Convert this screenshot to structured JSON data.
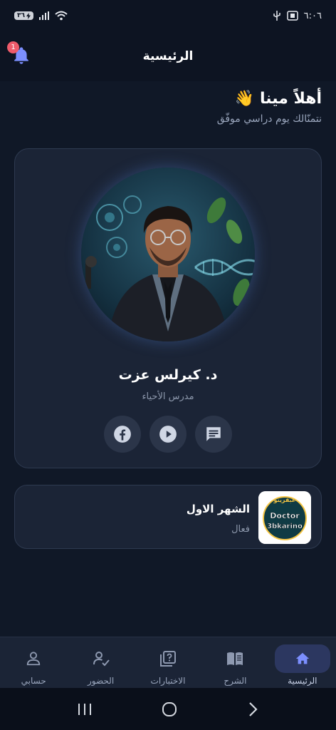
{
  "status_bar": {
    "time": "٦:٠٦",
    "battery": "٣٦"
  },
  "header": {
    "title": "الرئيسية",
    "notification_count": "1"
  },
  "greeting": {
    "title": "أهلاً مينا",
    "wave_emoji": "👋",
    "subtitle": "نتمنّالك يوم دراسي موفّق"
  },
  "teacher": {
    "name": "د. كيرلس عزت",
    "role": "مدرس الأحياء",
    "social": [
      {
        "icon": "facebook-icon"
      },
      {
        "icon": "youtube-play-icon"
      },
      {
        "icon": "chat-icon"
      }
    ]
  },
  "course": {
    "title": "الشهر الاول",
    "status": "فعال",
    "logo": {
      "top_text": "عبقرينو",
      "line1": "Doctor",
      "line2": "3bkarino"
    }
  },
  "bottom_nav": {
    "items": [
      {
        "label": "الرئيسية",
        "icon": "home-icon",
        "active": true
      },
      {
        "label": "الشرح",
        "icon": "book-icon",
        "active": false
      },
      {
        "label": "الاختبارات",
        "icon": "quiz-icon",
        "active": false
      },
      {
        "label": "الحضور",
        "icon": "attendance-icon",
        "active": false
      },
      {
        "label": "حسابي",
        "icon": "person-icon",
        "active": false
      }
    ]
  },
  "colors": {
    "background": "#101827",
    "card": "#1b2436",
    "accent": "#6f86ff",
    "badge": "#ef5b6b"
  }
}
